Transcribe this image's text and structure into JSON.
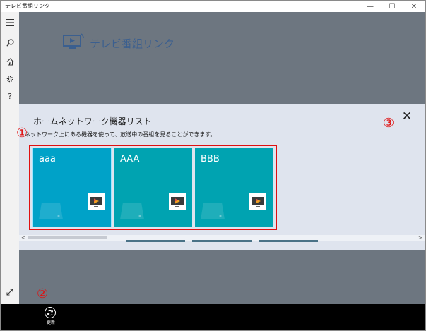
{
  "window": {
    "title": "テレビ番組リンク",
    "minimize": "—",
    "maximize": "☐",
    "close": "✕"
  },
  "sidebar": {
    "icons": [
      "hamburger-icon",
      "search-icon",
      "home-icon",
      "gear-icon",
      "help-icon"
    ],
    "help": "?",
    "bottom_icons": [
      "expand-icon",
      "exit-icon"
    ]
  },
  "header": {
    "app_name": "テレビ番組リンク"
  },
  "panel": {
    "title": "ホームネットワーク機器リスト",
    "description": "ネットワーク上にある機器を使って、放送中の番組を見ることができます。",
    "close": "✕",
    "devices": [
      {
        "label": "aaa",
        "selected": true
      },
      {
        "label": "AAA",
        "selected": false
      },
      {
        "label": "BBB",
        "selected": false
      }
    ]
  },
  "annotations": {
    "one": "①",
    "two": "②",
    "three": "③",
    "color": "#e01010"
  },
  "scrollbar": {
    "left": "<",
    "right": ">"
  },
  "commandbar": {
    "refresh_label": "更新"
  },
  "colors": {
    "tile": "#00a3b1",
    "tile_selected": "#00a2c8",
    "main_bg": "#6d7680",
    "panel_bg": "#dfe4ee",
    "logo": "#3b5f8f"
  }
}
